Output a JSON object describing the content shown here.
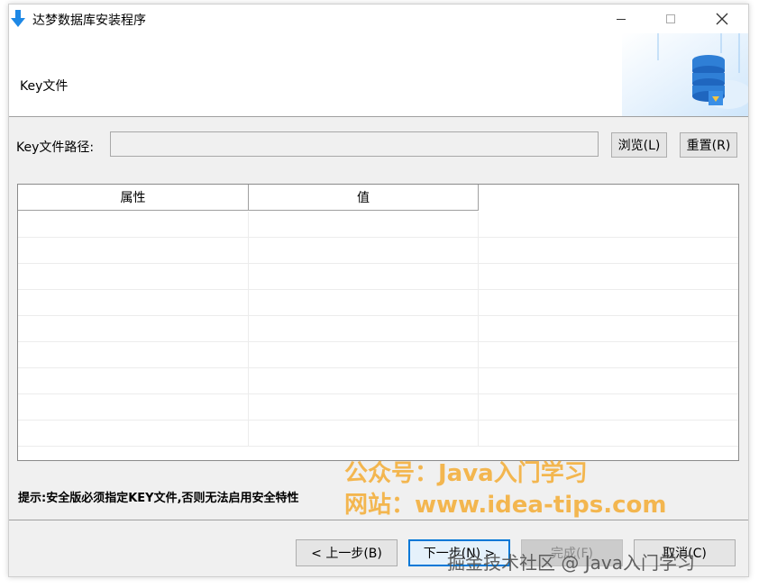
{
  "window": {
    "title": "达梦数据库安装程序",
    "header_title": "Key文件"
  },
  "key_path": {
    "label": "Key文件路径:",
    "value": "",
    "browse_label": "浏览(L)",
    "reset_label": "重置(R)"
  },
  "table": {
    "columns": [
      "属性",
      "值"
    ],
    "rows": []
  },
  "hint": "提示:安全版必须指定KEY文件,否则无法启用安全特性",
  "buttons": {
    "prev": "< 上一步(B)",
    "next": "下一步(N) >",
    "finish": "完成(F)",
    "cancel": "取消(C)"
  },
  "watermarks": {
    "line1": "公众号：Java入门学习",
    "line2": "网站：www.idea-tips.com",
    "line3": "掘金技术社区 @ Java入门学习"
  },
  "colors": {
    "accent": "#0078d7",
    "watermark": "#f5a623",
    "window_bg": "#f0f0f0"
  }
}
